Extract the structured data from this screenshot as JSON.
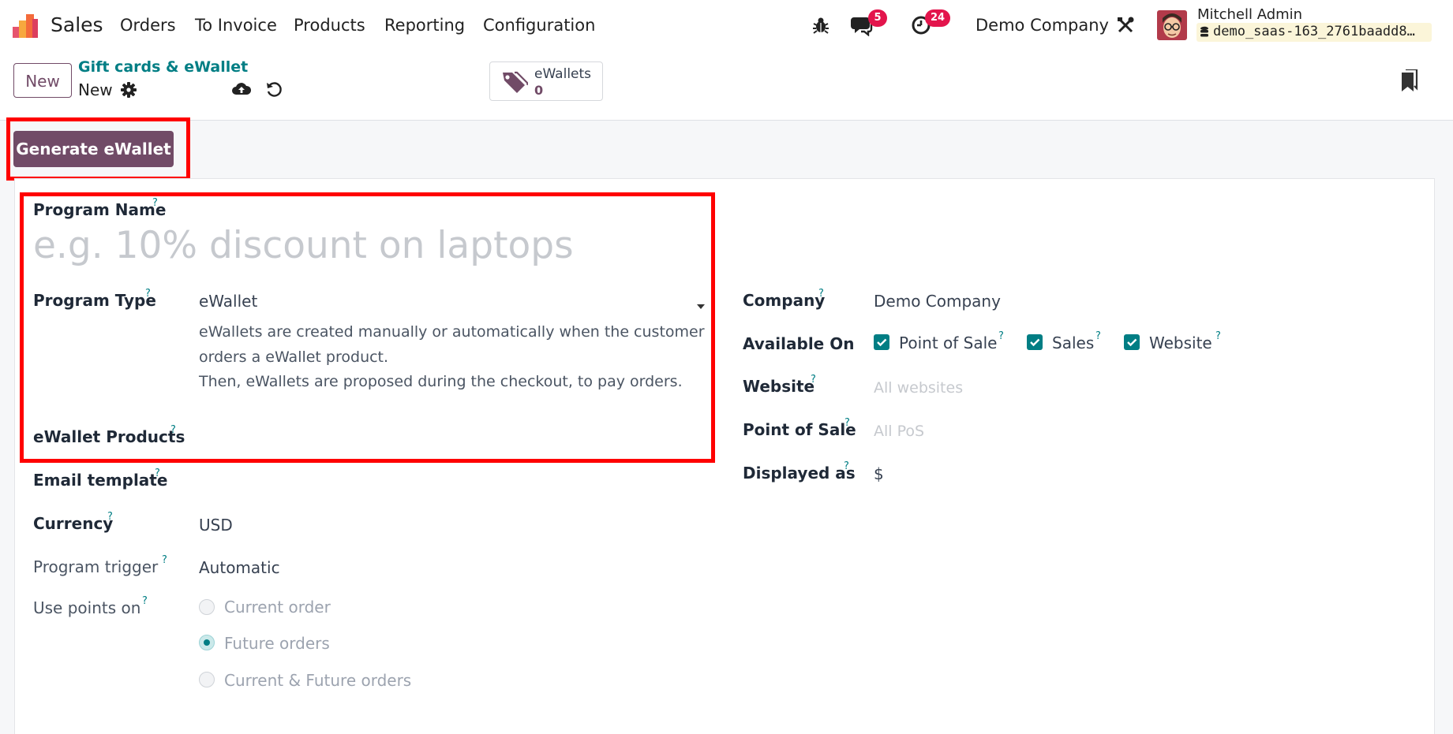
{
  "navbar": {
    "app_name": "Sales",
    "menu": [
      "Orders",
      "To Invoice",
      "Products",
      "Reporting",
      "Configuration"
    ],
    "messages_count": "5",
    "activities_count": "24",
    "company": "Demo Company",
    "user_name": "Mitchell Admin",
    "database": "demo_saas-163_2761baadd8…"
  },
  "control": {
    "new_button": "New",
    "breadcrumb_parent": "Gift cards & eWallet",
    "breadcrumb_current": "New",
    "stat_label": "eWallets",
    "stat_value": "0"
  },
  "actions": {
    "generate_button": "Generate eWallet"
  },
  "form": {
    "program_name_label": "Program Name",
    "program_name_placeholder": "e.g. 10% discount on laptops",
    "program_type_label": "Program Type",
    "program_type_value": "eWallet",
    "program_type_description_1": "eWallets are created manually or automatically when the customer orders a eWallet product.",
    "program_type_description_2": "Then, eWallets are proposed during the checkout, to pay orders.",
    "ewallet_products_label": "eWallet Products",
    "email_template_label": "Email template",
    "currency_label": "Currency",
    "currency_value": "USD",
    "program_trigger_label": "Program trigger",
    "program_trigger_value": "Automatic",
    "use_points_label": "Use points on",
    "use_points_options": [
      "Current order",
      "Future orders",
      "Current & Future orders"
    ],
    "use_points_selected": "Future orders",
    "company_label": "Company",
    "company_value": "Demo Company",
    "available_on_label": "Available On",
    "available_on_options": [
      "Point of Sale",
      "Sales",
      "Website"
    ],
    "website_label": "Website",
    "website_placeholder": "All websites",
    "pos_label": "Point of Sale",
    "pos_placeholder": "All PoS",
    "displayed_as_label": "Displayed as",
    "displayed_as_value": "$",
    "help_marker": "?"
  },
  "colors": {
    "brand": "#714b67",
    "accent": "#017e84",
    "badge": "#e3154c",
    "highlight": "#ff0000"
  }
}
